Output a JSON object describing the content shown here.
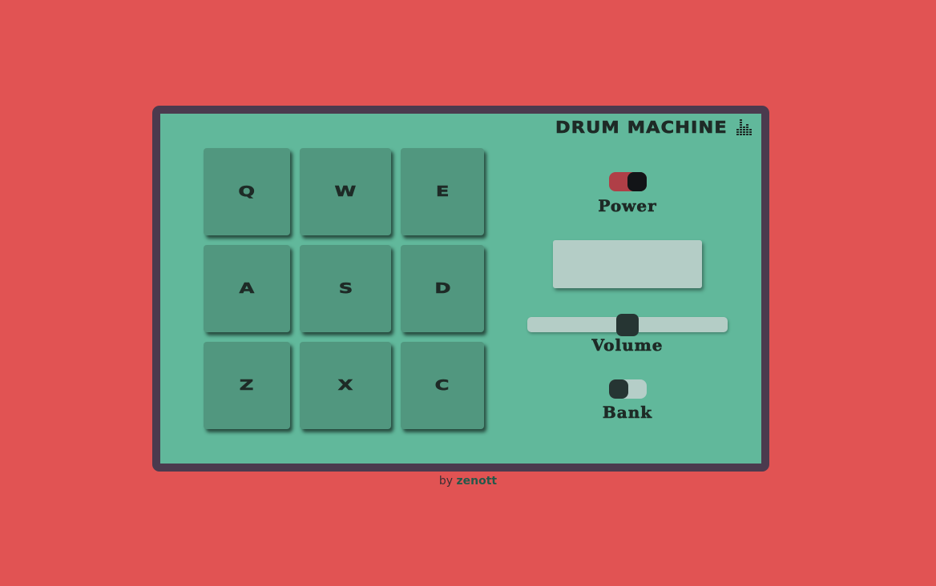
{
  "brand": {
    "title": "DRUM MACHINE",
    "icon": "equalizer-icon"
  },
  "pads": [
    {
      "key": "Q"
    },
    {
      "key": "W"
    },
    {
      "key": "E"
    },
    {
      "key": "A"
    },
    {
      "key": "S"
    },
    {
      "key": "D"
    },
    {
      "key": "Z"
    },
    {
      "key": "X"
    },
    {
      "key": "C"
    }
  ],
  "controls": {
    "power": {
      "label": "Power",
      "on": true
    },
    "display": {
      "text": ""
    },
    "volume": {
      "label": "Volume",
      "level": 0.5
    },
    "bank": {
      "label": "Bank",
      "on": false
    }
  },
  "footer": {
    "by": "by",
    "author": "zenott"
  },
  "colors": {
    "background": "#e15353",
    "panel": "#61b89b",
    "frame": "#4b3a4e",
    "pad": "#51977f",
    "text": "#1e2a26",
    "power_on": "#b03f47",
    "display": "#b4cdc6"
  }
}
